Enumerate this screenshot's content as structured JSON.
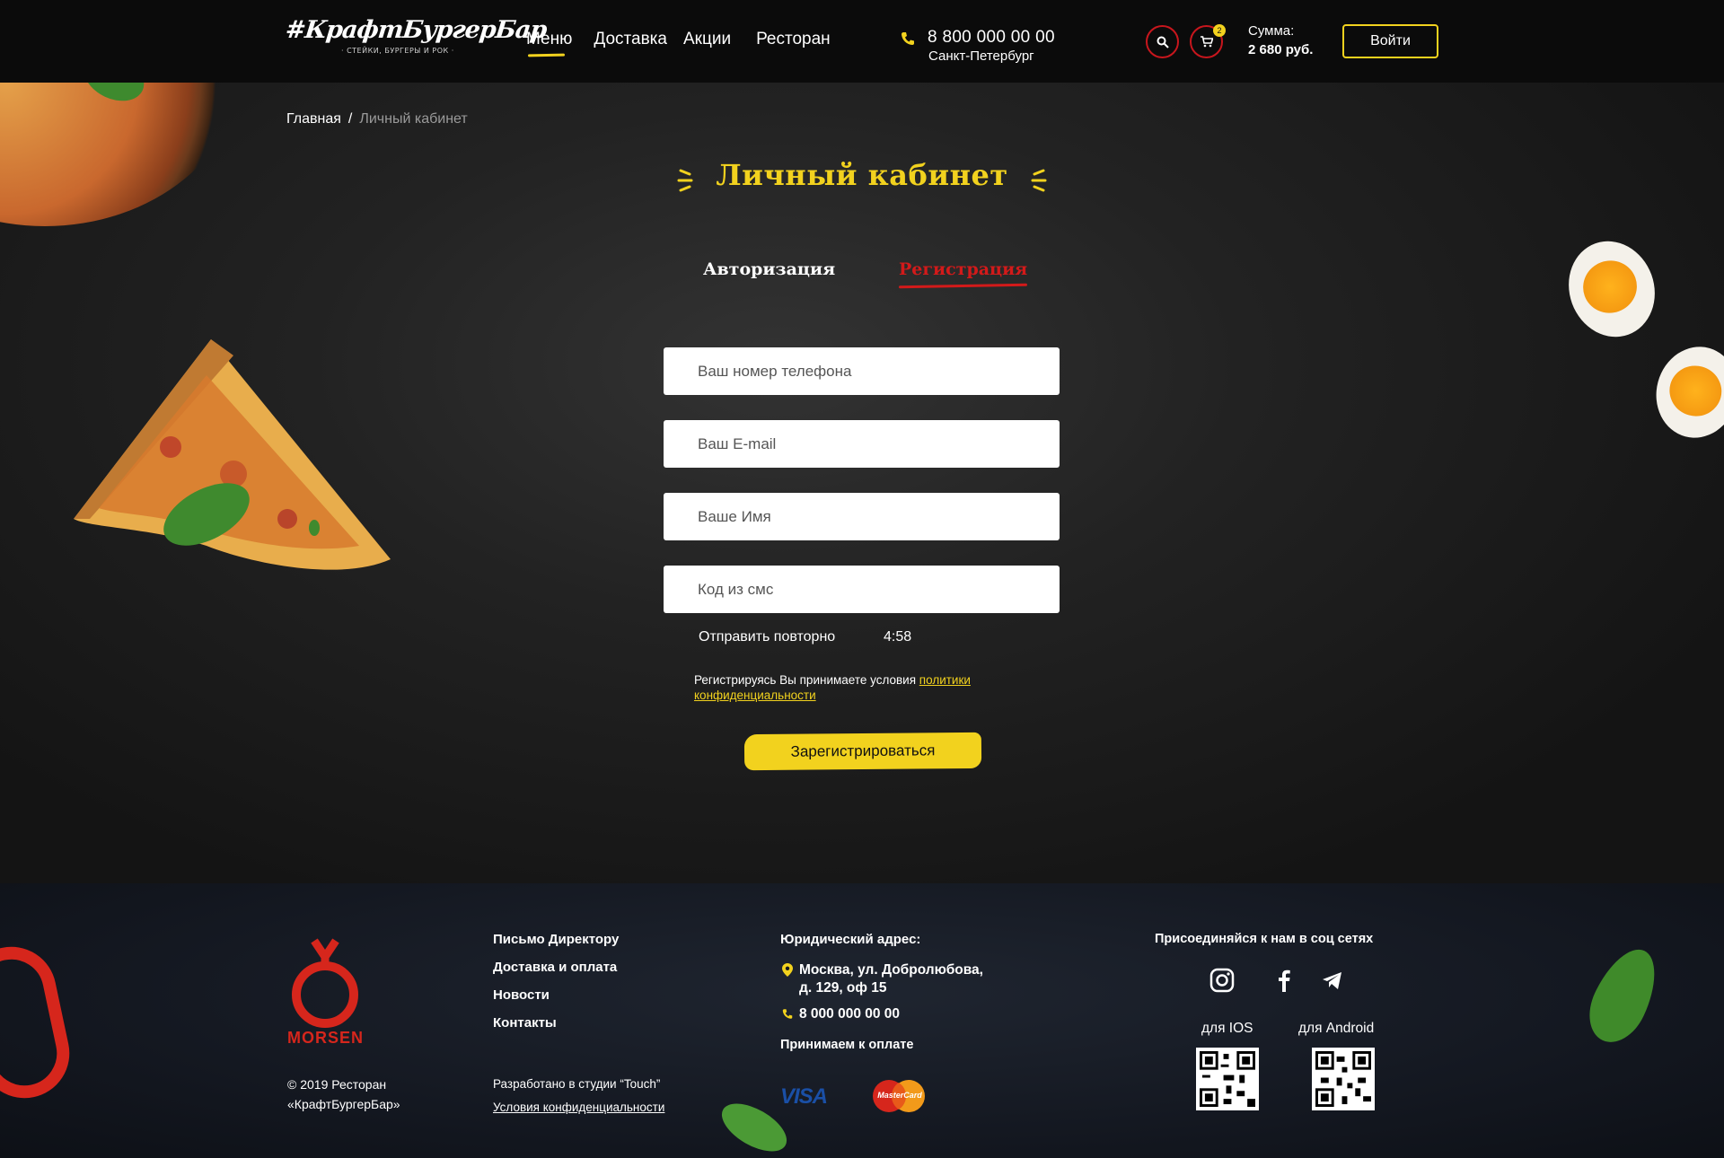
{
  "header": {
    "logo_text": "#КрафтБургерБар",
    "logo_sub": "· СТЕЙКИ, БУРГЕРЫ И РОК ·",
    "nav": [
      {
        "label": "Меню",
        "active": true
      },
      {
        "label": "Доставка",
        "active": false
      },
      {
        "label": "Акции",
        "active": false
      },
      {
        "label": "Ресторан",
        "active": false
      }
    ],
    "phone": "8 800 000 00 00",
    "city": "Санкт-Петербург",
    "cart_count": "2",
    "sum_label": "Сумма:",
    "sum_value": "2 680 руб.",
    "login_label": "Войти"
  },
  "breadcrumb": {
    "home": "Главная",
    "separator": "/",
    "current": "Личный кабинет"
  },
  "page": {
    "title": "Личный кабинет",
    "tabs": [
      {
        "label": "Авторизация",
        "active": false
      },
      {
        "label": "Регистрация",
        "active": true
      }
    ]
  },
  "form": {
    "phone_placeholder": "Ваш номер телефона",
    "email_placeholder": "Ваш E-mail",
    "name_placeholder": "Ваше Имя",
    "sms_placeholder": "Код из смс",
    "resend_label": "Отправить повторно",
    "timer": "4:58",
    "policy_text": "Регистрируясь Вы принимаете условия",
    "policy_link": "политики конфиденциальности",
    "submit_label": "Зарегистрироваться"
  },
  "footer": {
    "brand": "MORSEN",
    "copyright": "© 2019 Ресторан «КрафтБургерБар»",
    "links": [
      "Письмо Директору",
      "Доставка и оплата",
      "Новости",
      "Контакты"
    ],
    "studio": "Разработано в студии “Touch”",
    "terms": "Условия конфиденциальности",
    "legal_title": "Юридический адрес:",
    "address_line1": "Москва, ул. Добролюбова,",
    "address_line2": "д. 129, оф 15",
    "phone": "8 000 000 00 00",
    "payment_title": "Принимаем к оплате",
    "visa": "VISA",
    "mastercard": "MasterCard",
    "social_title": "Присоединяйся к нам в соц сетях",
    "ios_label": "для IOS",
    "android_label": "для Android"
  },
  "colors": {
    "accent_yellow": "#f2d21e",
    "accent_red": "#d31a1a",
    "header_bg": "#0b0b0b"
  }
}
